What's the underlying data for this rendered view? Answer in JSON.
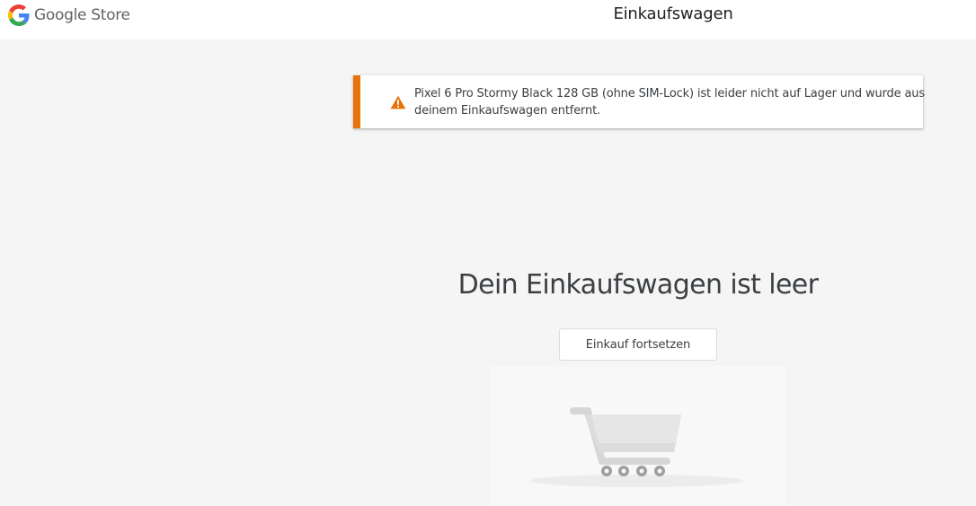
{
  "header": {
    "brand_name": "Google Store",
    "page_title": "Einkaufswagen"
  },
  "alert": {
    "icon": "warning-icon",
    "message": "Pixel 6 Pro Stormy Black 128 GB (ohne SIM-Lock) ist leider nicht auf Lager und wurde aus deinem Einkaufswagen entfernt.",
    "accent_color": "#e8710a"
  },
  "main": {
    "empty_heading": "Dein Einkaufswagen ist leer",
    "continue_label": "Einkauf fortsetzen",
    "illustration": "shopping-cart-illustration"
  }
}
